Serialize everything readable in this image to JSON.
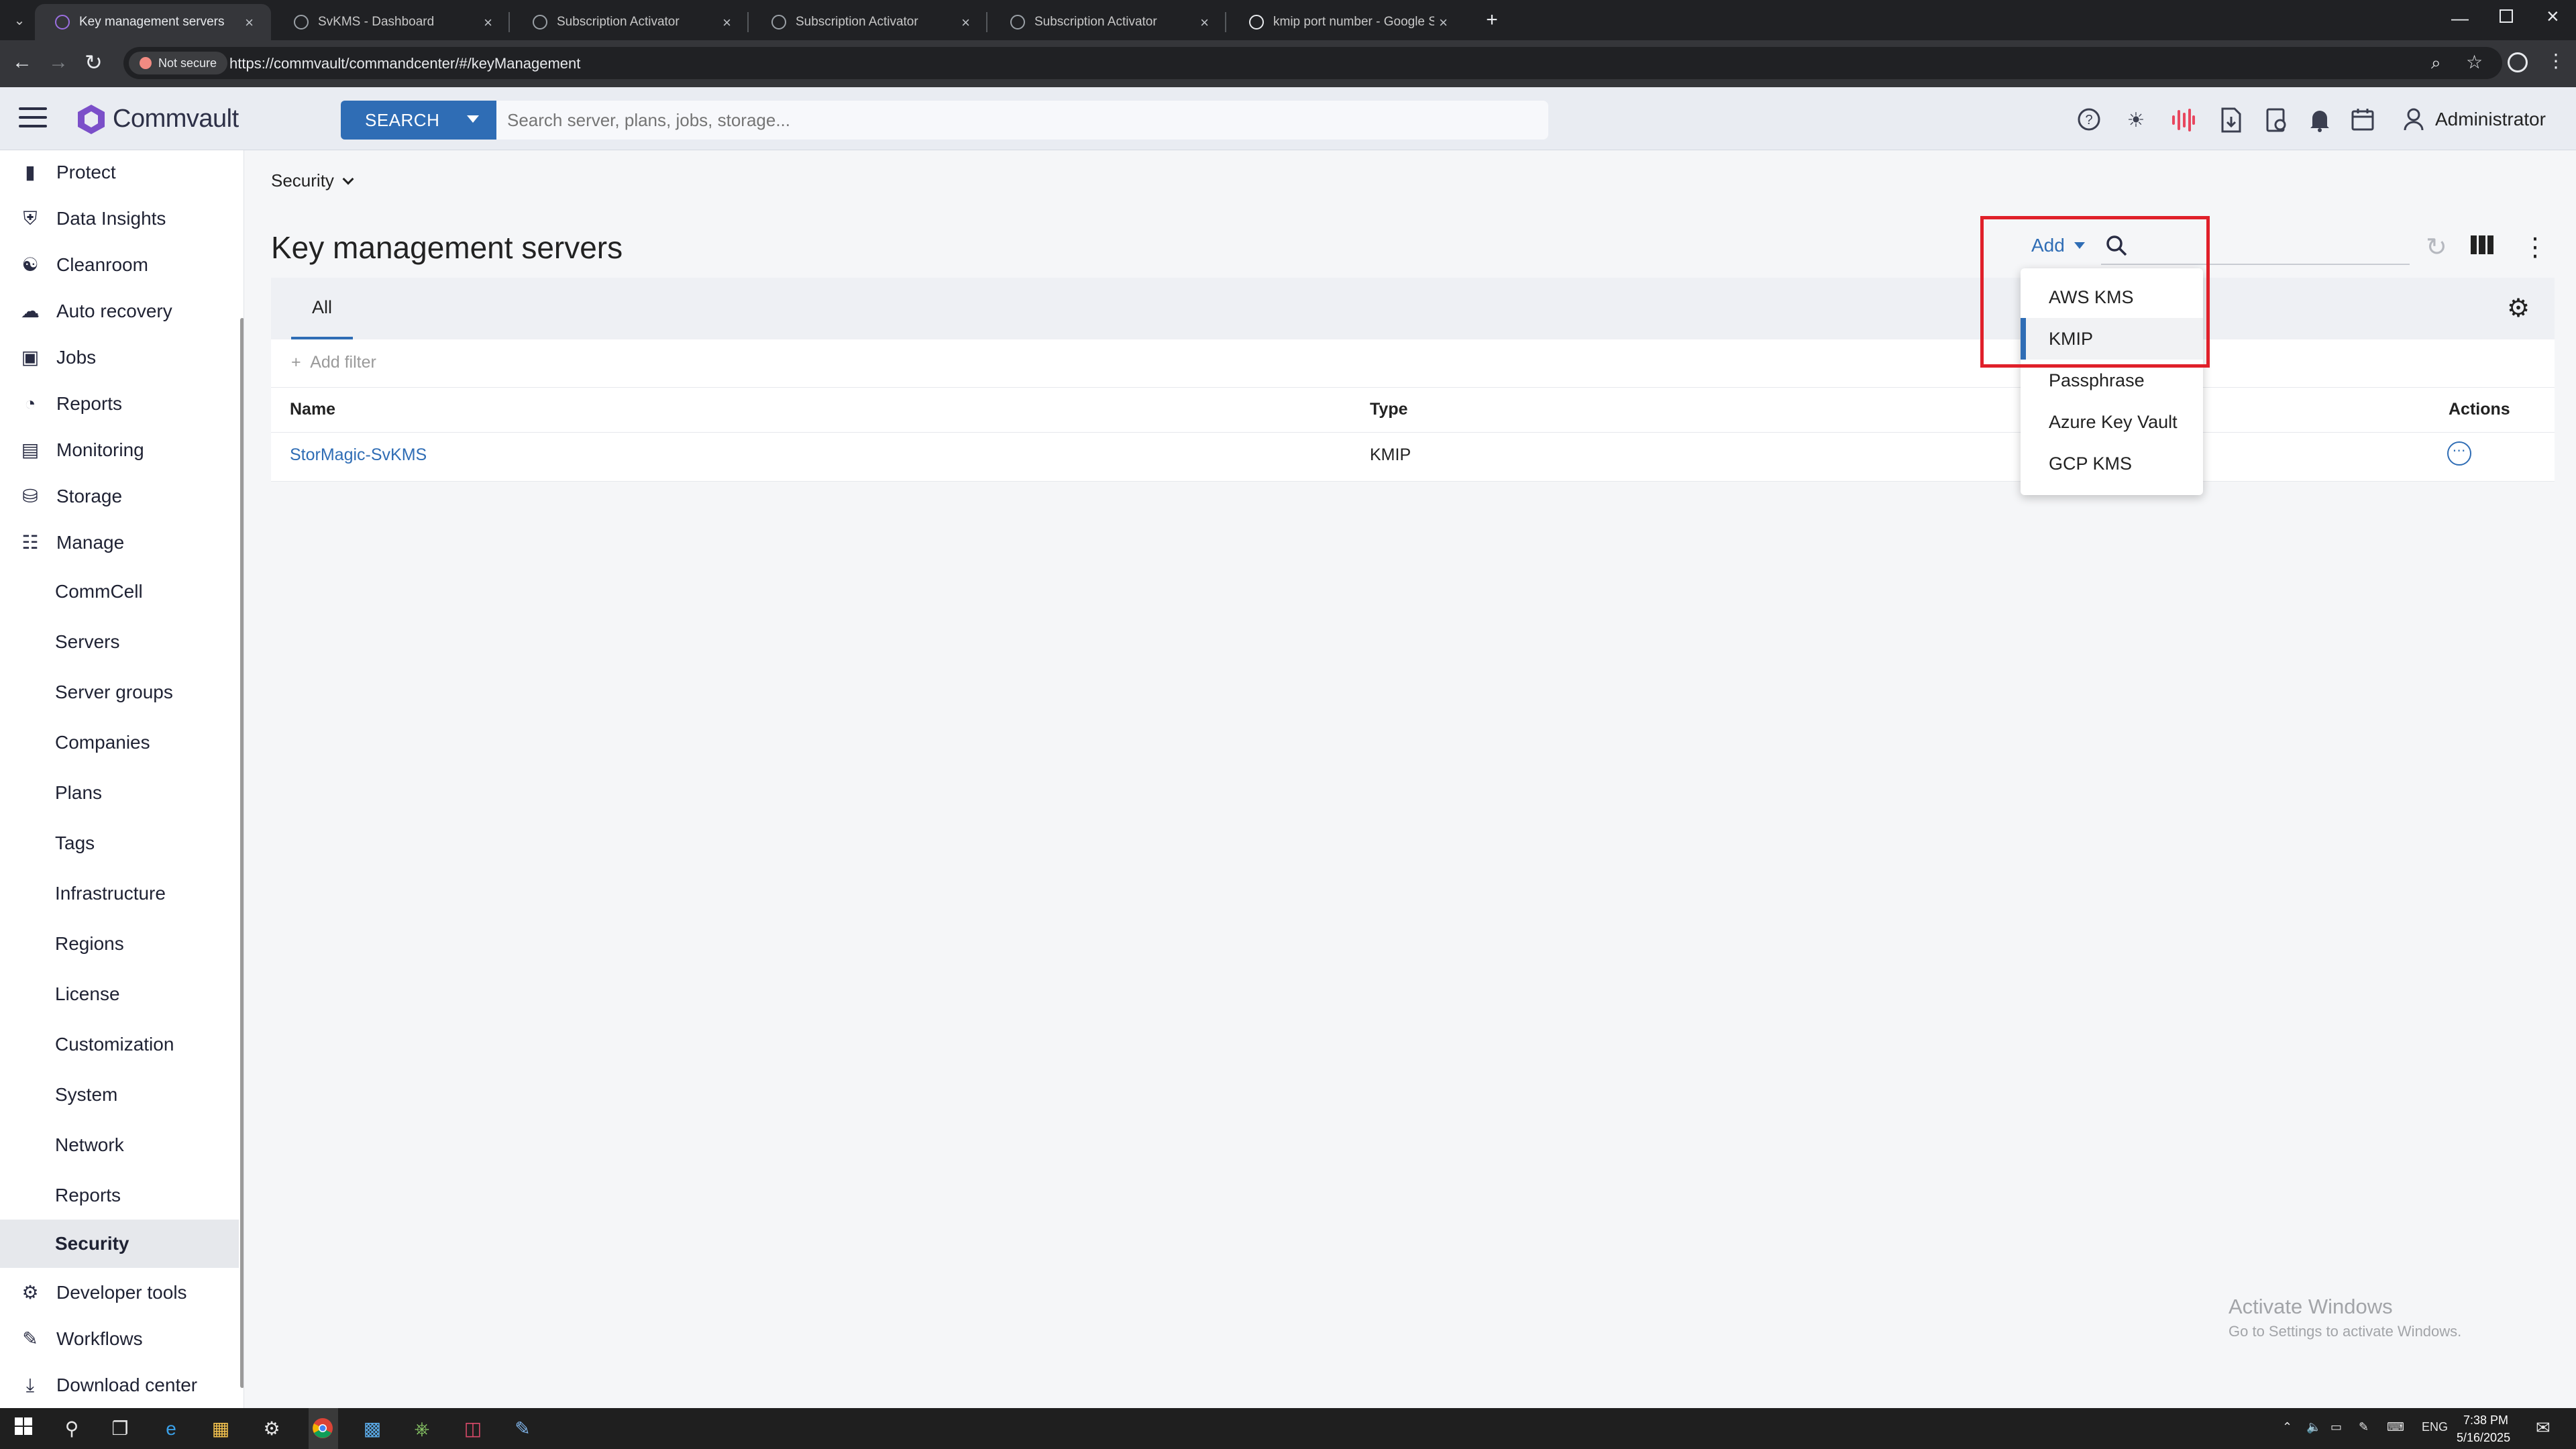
{
  "browser": {
    "tabs": [
      {
        "title": "Key management servers",
        "active": true
      },
      {
        "title": "SvKMS - Dashboard",
        "active": false
      },
      {
        "title": "Subscription Activator",
        "active": false
      },
      {
        "title": "Subscription Activator",
        "active": false
      },
      {
        "title": "Subscription Activator",
        "active": false
      },
      {
        "title": "kmip port number - Google Se",
        "active": false
      }
    ],
    "security_label": "Not secure",
    "url": "https://commvault/commandcenter/#/keyManagement"
  },
  "header": {
    "brand": "Commvault",
    "search_button": "SEARCH",
    "search_placeholder": "Search server, plans, jobs, storage...",
    "user": "Administrator",
    "icons": [
      "help-icon",
      "theme-icon",
      "activity-icon",
      "download-report-icon",
      "reports-icon",
      "bell-icon",
      "calendar-icon",
      "user-icon"
    ]
  },
  "sidebar": {
    "items": [
      {
        "label": "Protect",
        "icon": "protect-icon"
      },
      {
        "label": "Data Insights",
        "icon": "shield-icon"
      },
      {
        "label": "Cleanroom",
        "icon": "cleanroom-icon"
      },
      {
        "label": "Auto recovery",
        "icon": "cloud-recovery-icon"
      },
      {
        "label": "Jobs",
        "icon": "briefcase-icon"
      },
      {
        "label": "Reports",
        "icon": "gauge-icon"
      },
      {
        "label": "Monitoring",
        "icon": "monitor-icon"
      },
      {
        "label": "Storage",
        "icon": "database-icon"
      },
      {
        "label": "Manage",
        "icon": "sliders-icon"
      }
    ],
    "manage_subitems": [
      "CommCell",
      "Servers",
      "Server groups",
      "Companies",
      "Plans",
      "Tags",
      "Infrastructure",
      "Regions",
      "License",
      "Customization",
      "System",
      "Network",
      "Reports",
      "Security"
    ],
    "selected": "Security",
    "bottom_items": [
      {
        "label": "Developer tools",
        "icon": "developer-icon"
      },
      {
        "label": "Workflows",
        "icon": "workflow-icon"
      },
      {
        "label": "Download center",
        "icon": "download-icon"
      }
    ]
  },
  "main": {
    "breadcrumb": "Security",
    "title": "Key management servers",
    "tabs": [
      "All"
    ],
    "add_filter": "Add filter",
    "toolbar": {
      "add_label": "Add"
    },
    "table": {
      "columns": [
        "Name",
        "Type",
        "Actions"
      ],
      "rows": [
        {
          "name": "StorMagic-SvKMS",
          "type": "KMIP"
        }
      ]
    },
    "add_menu": {
      "options": [
        "AWS KMS",
        "KMIP",
        "Passphrase",
        "Azure Key Vault",
        "GCP KMS"
      ],
      "highlighted": "KMIP"
    }
  },
  "watermark": {
    "line1": "Activate Windows",
    "line2": "Go to Settings to activate Windows."
  },
  "taskbar": {
    "language": "ENG",
    "time": "7:38 PM",
    "date": "5/16/2025"
  },
  "colors": {
    "accent": "#2f6db5",
    "highlight_box": "#e0202a",
    "logo": "#7b4fc9"
  }
}
